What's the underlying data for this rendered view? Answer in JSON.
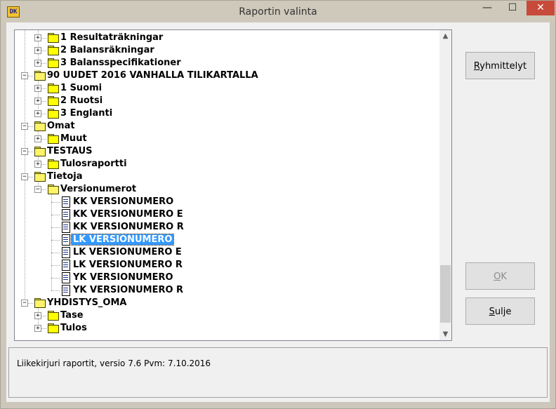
{
  "window": {
    "title": "Raportin valinta",
    "icon_text": "DK",
    "min_glyph": "—",
    "max_glyph": "☐",
    "close_glyph": "✕"
  },
  "tree": {
    "selected": "LK VERSIONUMERO",
    "rows": [
      {
        "label": "1 Resultaträkningar",
        "type": "folder",
        "level": 2,
        "expander": "+"
      },
      {
        "label": "2 Balansräkningar",
        "type": "folder",
        "level": 2,
        "expander": "+"
      },
      {
        "label": "3 Balansspecifikationer",
        "type": "folder",
        "level": 2,
        "expander": "+"
      },
      {
        "label": "90 UUDET 2016 VANHALLA TILIKARTALLA",
        "type": "folder-open",
        "level": 1,
        "expander": "−"
      },
      {
        "label": "1 Suomi",
        "type": "folder",
        "level": 2,
        "expander": "+"
      },
      {
        "label": "2 Ruotsi",
        "type": "folder",
        "level": 2,
        "expander": "+"
      },
      {
        "label": "3 Englanti",
        "type": "folder",
        "level": 2,
        "expander": "+"
      },
      {
        "label": "Omat",
        "type": "folder-open",
        "level": 1,
        "expander": "−"
      },
      {
        "label": "Muut",
        "type": "folder",
        "level": 2,
        "expander": "+"
      },
      {
        "label": "TESTAUS",
        "type": "folder-open",
        "level": 1,
        "expander": "−"
      },
      {
        "label": "Tulosraportti",
        "type": "folder",
        "level": 2,
        "expander": "+"
      },
      {
        "label": "Tietoja",
        "type": "folder-open",
        "level": 1,
        "expander": "−"
      },
      {
        "label": "Versionumerot",
        "type": "folder-open",
        "level": 2,
        "expander": "−"
      },
      {
        "label": "KK VERSIONUMERO",
        "type": "doc",
        "level": 3
      },
      {
        "label": "KK VERSIONUMERO E",
        "type": "doc",
        "level": 3
      },
      {
        "label": "KK VERSIONUMERO R",
        "type": "doc",
        "level": 3
      },
      {
        "label": "LK VERSIONUMERO",
        "type": "doc",
        "level": 3,
        "selected": true
      },
      {
        "label": "LK VERSIONUMERO E",
        "type": "doc",
        "level": 3
      },
      {
        "label": "LK VERSIONUMERO R",
        "type": "doc",
        "level": 3
      },
      {
        "label": "YK VERSIONUMERO",
        "type": "doc",
        "level": 3
      },
      {
        "label": "YK VERSIONUMERO R",
        "type": "doc",
        "level": 3
      },
      {
        "label": "YHDISTYS_OMA",
        "type": "folder-open",
        "level": 1,
        "expander": "−"
      },
      {
        "label": "Tase",
        "type": "folder",
        "level": 2,
        "expander": "+"
      },
      {
        "label": "Tulos",
        "type": "folder",
        "level": 2,
        "expander": "+"
      }
    ],
    "scroll": {
      "thumb_start_fraction": 0.78,
      "thumb_size_fraction": 0.2
    },
    "scroll_up_glyph": "▲",
    "scroll_down_glyph": "▼"
  },
  "buttons": {
    "ryhmittelyt": {
      "mnemonic": "R",
      "rest": "yhmittelyt"
    },
    "ok": {
      "mnemonic": "O",
      "rest": "K"
    },
    "sulje": {
      "mnemonic": "S",
      "rest": "ulje"
    }
  },
  "status": {
    "text": "Liikekirjuri raportit, versio 7.6  Pvm: 7.10.2016"
  }
}
